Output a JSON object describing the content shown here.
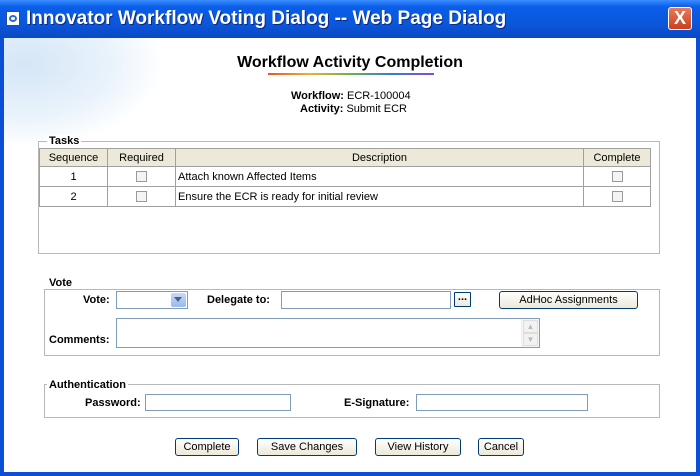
{
  "window": {
    "title": "Innovator Workflow Voting Dialog -- Web Page Dialog",
    "close_label": "X"
  },
  "page": {
    "heading": "Workflow Activity Completion",
    "workflow_label": "Workflow:",
    "workflow_value": "ECR-100004",
    "activity_label": "Activity:",
    "activity_value": "Submit ECR"
  },
  "tasks": {
    "legend": "Tasks",
    "columns": [
      "Sequence",
      "Required",
      "Description",
      "Complete"
    ],
    "rows": [
      {
        "sequence": "1",
        "description": "Attach known Affected Items",
        "required": false,
        "complete": false
      },
      {
        "sequence": "2",
        "description": "Ensure the ECR is ready for initial review",
        "required": false,
        "complete": false
      }
    ]
  },
  "vote": {
    "legend": "Vote",
    "vote_label": "Vote:",
    "vote_selected": "",
    "delegate_label": "Delegate to:",
    "delegate_value": "",
    "ellipsis_label": "...",
    "adhoc_label": "AdHoc Assignments",
    "comments_label": "Comments:",
    "comments_value": ""
  },
  "auth": {
    "legend": "Authentication",
    "password_label": "Password:",
    "esignature_label": "E-Signature:"
  },
  "buttons": {
    "complete": "Complete",
    "save": "Save Changes",
    "history": "View History",
    "cancel": "Cancel"
  }
}
